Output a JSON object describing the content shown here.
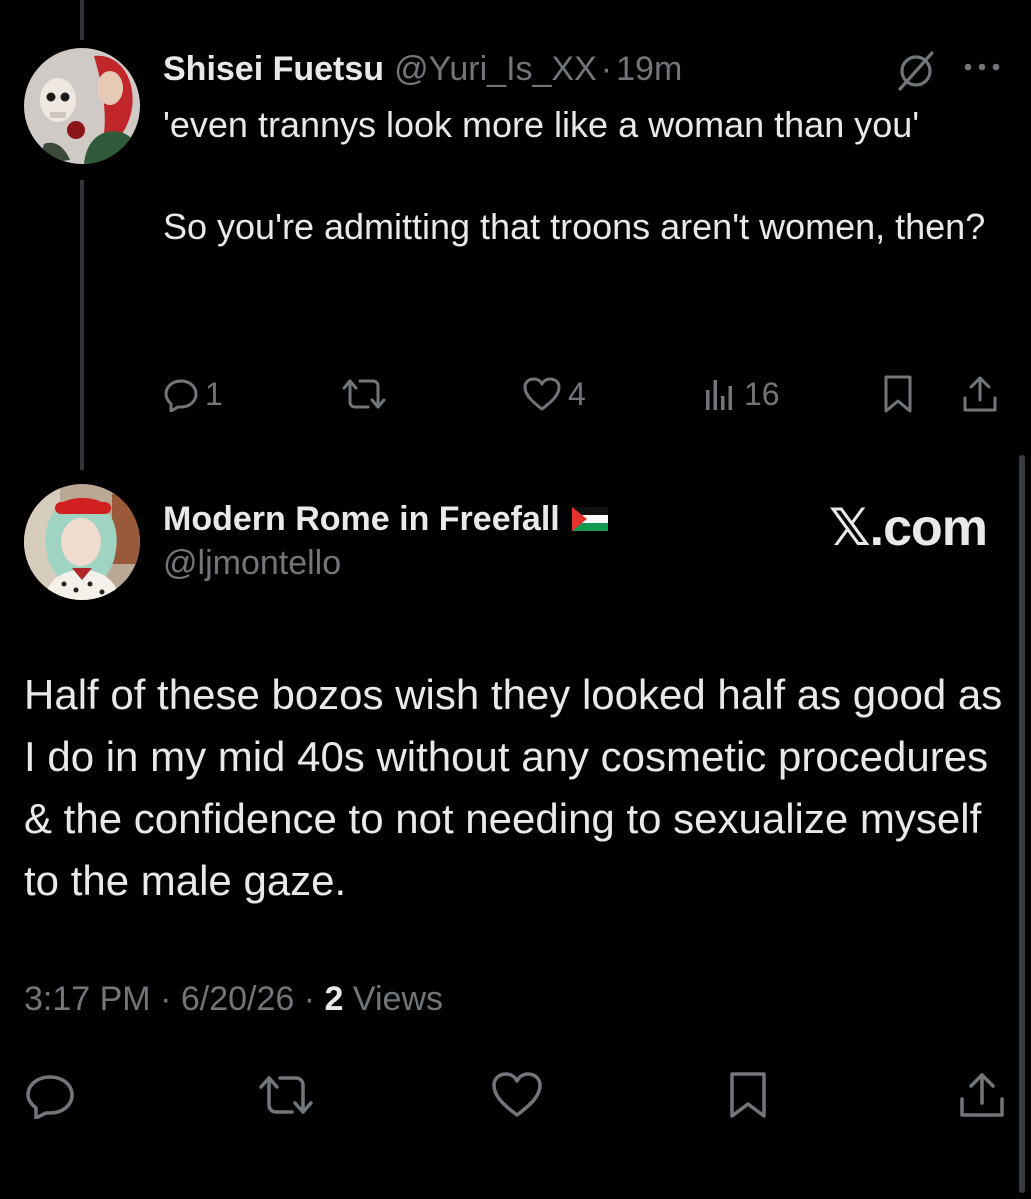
{
  "reply": {
    "display_name": "Shisei Fuetsu",
    "handle": "@Yuri_Is_XX",
    "separator": "·",
    "time": "19m",
    "text_line1": "'even trannys look more like a woman than you'",
    "text_line2": "So you're admitting that troons aren't women, then?",
    "actions": {
      "reply_count": "1",
      "like_count": "4",
      "views_count": "16"
    }
  },
  "main_post": {
    "display_name": "Modern Rome in Freefall",
    "handle": "@ljmontello",
    "text": "Half of these bozos wish they looked half as good as  I do in my mid 40s without any cosmetic procedures & the confidence to not needing to sexualize myself to the male gaze.",
    "time": "3:17 PM",
    "date": "6/20/26",
    "separator": "·",
    "views_count": "2",
    "views_label": "Views"
  },
  "watermark": "𝕏.com",
  "icons": [
    "grok-icon",
    "more-icon",
    "reply-icon",
    "repost-icon",
    "like-icon",
    "views-icon",
    "bookmark-icon",
    "share-icon",
    "palestine-flag-icon"
  ],
  "colors": {
    "background": "#000000",
    "text_primary": "#e7e9ea",
    "text_secondary": "#71767b",
    "thread_line": "#333639"
  }
}
